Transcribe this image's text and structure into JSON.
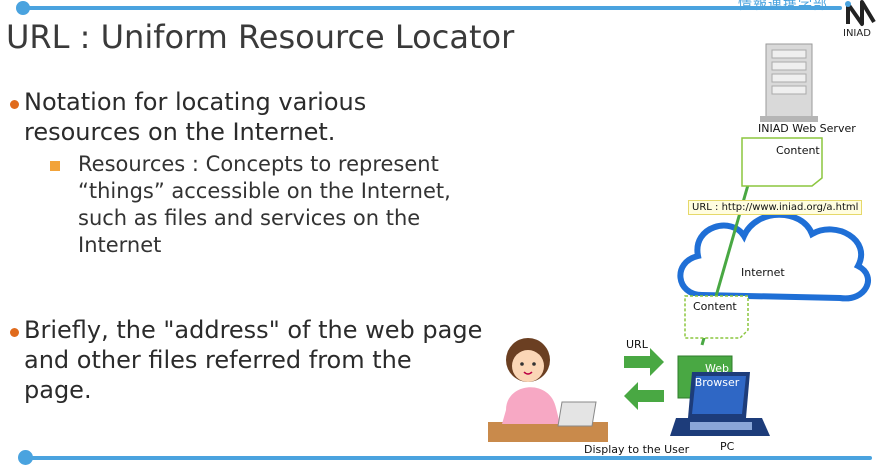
{
  "header": {
    "title": "URL : Uniform Resource Locator",
    "dept": "情報連携学部",
    "logo_text": "INIAD"
  },
  "bullets": [
    {
      "text_l1": "Notation for locating various",
      "text_l2": "resources on the Internet."
    },
    {
      "text_l1": "Briefly, the \"address\" of the web page",
      "text_l2": "and other files referred from the",
      "text_l3": "page."
    }
  ],
  "sub": {
    "l1": "Resources : Concepts to represent",
    "l2": "“things” accessible on the Internet,",
    "l3": "such as files and services on the",
    "l4": "Internet"
  },
  "diagram": {
    "server_label": "INIAD Web Server",
    "content_top": "Content",
    "url_label": "URL : http://www.iniad.org/a.html",
    "internet_label": "Internet",
    "content_bottom": "Content",
    "url_arrow_label": "URL",
    "browser_l1": "Web",
    "browser_l2": "Browser",
    "pc_label": "PC",
    "display_label": "Display to the User"
  },
  "colors": {
    "accent": "#4aa3df",
    "bullet": "#e06b1d",
    "sub_bullet": "#f2a33a",
    "green": "#49a843",
    "cloud": "#1f6fd6"
  }
}
